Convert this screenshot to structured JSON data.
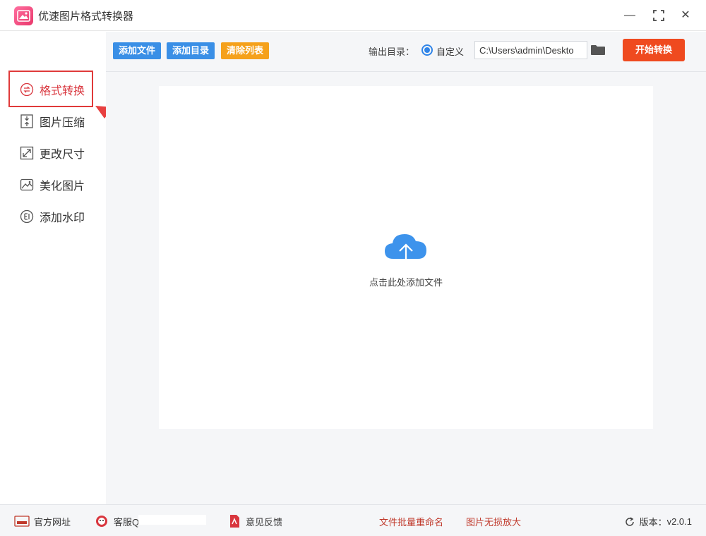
{
  "window": {
    "title": "优速图片格式转换器",
    "minimize_glyph": "—",
    "maximize_glyph": "⛶",
    "close_glyph": "✕"
  },
  "sidebar": {
    "items": [
      {
        "label": "格式转换",
        "icon": "convert-icon",
        "active": true
      },
      {
        "label": "图片压缩",
        "icon": "compress-icon",
        "active": false
      },
      {
        "label": "更改尺寸",
        "icon": "resize-icon",
        "active": false
      },
      {
        "label": "美化图片",
        "icon": "beautify-icon",
        "active": false
      },
      {
        "label": "添加水印",
        "icon": "watermark-icon",
        "active": false
      }
    ]
  },
  "toolbar": {
    "add_file": "添加文件",
    "add_folder": "添加目录",
    "clear_list": "清除列表",
    "output_label": "输出目录：",
    "output_option": "自定义",
    "output_path": "C:\\Users\\admin\\Deskto",
    "start": "开始转换"
  },
  "dropzone": {
    "hint": "点击此处添加文件"
  },
  "footer": {
    "website": "官方网址",
    "support": "客服Q",
    "feedback": "意见反馈",
    "batch_rename": "文件批量重命名",
    "lossless_enlarge": "图片无损放大",
    "version_label": "版本：",
    "version": "v2.0.1"
  },
  "colors": {
    "accent_blue": "#3a8fe6",
    "accent_orange": "#f5a11b",
    "start_red": "#ef4a1f",
    "active_red": "#d9363e",
    "cloud_blue": "#3d93ec"
  }
}
